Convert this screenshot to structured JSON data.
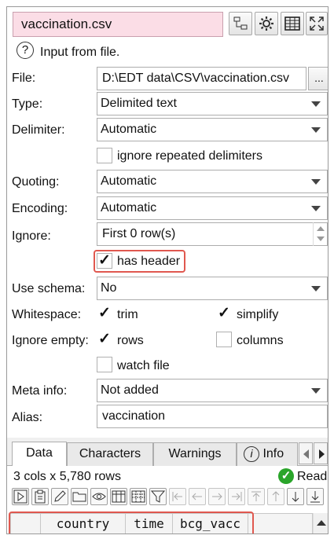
{
  "title": "vaccination.csv",
  "input_from_file": "Input from file.",
  "file": {
    "label": "File:",
    "value": "D:\\EDT data\\CSV\\vaccination.csv",
    "browse": "..."
  },
  "type": {
    "label": "Type:",
    "value": "Delimited text"
  },
  "delimiter": {
    "label": "Delimiter:",
    "value": "Automatic",
    "ignore_repeated": "ignore repeated delimiters",
    "ignore_repeated_checked": false
  },
  "quoting": {
    "label": "Quoting:",
    "value": "Automatic"
  },
  "encoding": {
    "label": "Encoding:",
    "value": "Automatic"
  },
  "ignore": {
    "label": "Ignore:",
    "value": "First 0 row(s)"
  },
  "has_header": {
    "label": "has header",
    "checked": true
  },
  "use_schema": {
    "label": "Use schema:",
    "value": "No"
  },
  "whitespace": {
    "label": "Whitespace:",
    "trim": "trim",
    "trim_checked": true,
    "simplify": "simplify",
    "simplify_checked": true
  },
  "ignore_empty": {
    "label": "Ignore empty:",
    "rows": "rows",
    "rows_checked": true,
    "columns": "columns",
    "columns_checked": false
  },
  "watch_file": {
    "label": "watch file",
    "checked": false
  },
  "meta_info": {
    "label": "Meta info:",
    "value": "Not added"
  },
  "alias": {
    "label": "Alias:",
    "value": "vaccination"
  },
  "tabs": [
    "Data",
    "Characters",
    "Warnings",
    "Info"
  ],
  "status": {
    "summary": "3 cols x 5,780 rows",
    "read": "Read"
  },
  "columns": [
    "country",
    "time",
    "bcg_vacc"
  ],
  "check_mark": "✓",
  "colors": {
    "title_bg": "#fbdde6",
    "highlight": "#e0584f",
    "ok": "#2aa52a"
  }
}
